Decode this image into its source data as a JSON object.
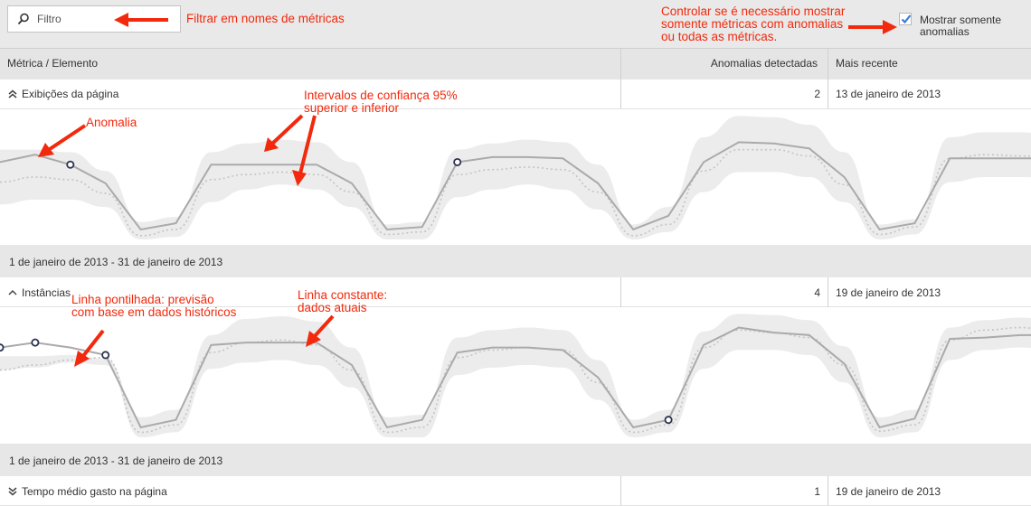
{
  "filter": {
    "placeholder": "Filtro"
  },
  "options": {
    "show_anomalies_only_label": "Mostrar somente anomalias",
    "show_anomalies_only_checked": true
  },
  "annotations": {
    "filter_note": "Filtrar em nomes de métricas",
    "toggle_note": [
      "Controlar se é necessário mostrar",
      "somente métricas com anomalias",
      "ou todas as métricas."
    ],
    "anomaly_note": "Anomalia",
    "confidence_note": [
      "Intervalos de confiança 95%",
      "superior e inferior"
    ],
    "dotted_note": [
      "Linha pontilhada: previsão",
      "com base em dados históricos"
    ],
    "solid_note": [
      "Linha constante:",
      "dados atuais"
    ]
  },
  "table": {
    "columns": [
      "Métrica / Elemento",
      "Anomalias detectadas",
      "Mais recente"
    ],
    "rows": [
      {
        "metric": "Exibições da página",
        "anomalies": "2",
        "latest": "13 de janeiro de 2013",
        "expanded": true,
        "range": "1 de janeiro de 2013 - 31 de janeiro de 2013"
      },
      {
        "metric": "Instâncias",
        "anomalies": "4",
        "latest": "19 de janeiro de 2013",
        "expanded": true,
        "range": "1 de janeiro de 2013 - 31 de janeiro de 2013"
      },
      {
        "metric": "Tempo médio gasto na página",
        "anomalies": "1",
        "latest": "19 de janeiro de 2013",
        "expanded": false
      }
    ]
  },
  "colors": {
    "annotation": "#f2290c",
    "actual_line": "#aaaaaa",
    "band": "#ececec",
    "anomaly_marker": "#2b3350",
    "check": "#3c7bd6"
  },
  "chart_data": [
    {
      "type": "line",
      "metric": "Exibições da página",
      "x": [
        1,
        2,
        3,
        4,
        5,
        6,
        7,
        8,
        9,
        10,
        11,
        12,
        13,
        14,
        15,
        16,
        17,
        18,
        19,
        20,
        21,
        22,
        23,
        24,
        25,
        26,
        27,
        28,
        29,
        30,
        31
      ],
      "series": [
        {
          "values": [
            0.62,
            0.68,
            0.6,
            0.45,
            0.08,
            0.13,
            0.6,
            0.6,
            0.6,
            0.6,
            0.45,
            0.08,
            0.1,
            0.62,
            0.66,
            0.66,
            0.65,
            0.45,
            0.08,
            0.19,
            0.62,
            0.78,
            0.77,
            0.73,
            0.5,
            0.08,
            0.13,
            0.65,
            0.65,
            0.65,
            0.65
          ]
        },
        {
          "values": [
            0.46,
            0.5,
            0.48,
            0.37,
            0.03,
            0.08,
            0.48,
            0.52,
            0.54,
            0.52,
            0.38,
            0.04,
            0.06,
            0.52,
            0.56,
            0.58,
            0.56,
            0.38,
            0.03,
            0.12,
            0.55,
            0.72,
            0.72,
            0.67,
            0.44,
            0.04,
            0.1,
            0.65,
            0.68,
            0.67,
            0.66
          ]
        },
        {
          "values": [
            0.72,
            0.72,
            0.7,
            0.55,
            0.14,
            0.18,
            0.7,
            0.77,
            0.8,
            0.78,
            0.62,
            0.12,
            0.14,
            0.72,
            0.77,
            0.8,
            0.78,
            0.6,
            0.12,
            0.26,
            0.82,
            0.99,
            0.98,
            0.92,
            0.7,
            0.12,
            0.16,
            0.82,
            0.86,
            0.86,
            0.83
          ]
        },
        {
          "values": [
            0.28,
            0.32,
            0.32,
            0.26,
            0.0,
            0.02,
            0.3,
            0.4,
            0.44,
            0.4,
            0.26,
            0.0,
            0.0,
            0.34,
            0.4,
            0.44,
            0.4,
            0.24,
            0.0,
            0.06,
            0.38,
            0.54,
            0.54,
            0.5,
            0.3,
            0.0,
            0.04,
            0.46,
            0.5,
            0.5,
            0.49
          ]
        }
      ],
      "anomalies": [
        2,
        13
      ]
    },
    {
      "type": "line",
      "metric": "Instâncias",
      "x": [
        1,
        2,
        3,
        4,
        5,
        6,
        7,
        8,
        9,
        10,
        11,
        12,
        13,
        14,
        15,
        16,
        17,
        18,
        19,
        20,
        21,
        22,
        23,
        24,
        25,
        26,
        27,
        28,
        29,
        30,
        31
      ],
      "series": [
        {
          "values": [
            0.72,
            0.76,
            0.72,
            0.66,
            0.08,
            0.14,
            0.74,
            0.76,
            0.76,
            0.76,
            0.58,
            0.08,
            0.14,
            0.68,
            0.72,
            0.72,
            0.7,
            0.48,
            0.08,
            0.14,
            0.74,
            0.88,
            0.84,
            0.82,
            0.59,
            0.08,
            0.15,
            0.79,
            0.8,
            0.82,
            0.82
          ]
        },
        {
          "values": [
            0.54,
            0.58,
            0.62,
            0.64,
            0.04,
            0.1,
            0.68,
            0.76,
            0.78,
            0.74,
            0.54,
            0.04,
            0.08,
            0.64,
            0.7,
            0.72,
            0.7,
            0.44,
            0.04,
            0.1,
            0.72,
            0.86,
            0.84,
            0.8,
            0.58,
            0.05,
            0.1,
            0.78,
            0.86,
            0.88,
            0.85
          ]
        },
        {
          "values": [
            0.65,
            0.65,
            0.66,
            0.63,
            0.16,
            0.22,
            0.82,
            0.95,
            0.97,
            0.93,
            0.72,
            0.16,
            0.18,
            0.8,
            0.86,
            0.88,
            0.86,
            0.62,
            0.14,
            0.22,
            0.85,
            0.99,
            0.98,
            0.94,
            0.73,
            0.16,
            0.22,
            0.88,
            0.94,
            0.96,
            0.94
          ]
        },
        {
          "values": [
            0.54,
            0.56,
            0.6,
            0.58,
            0.0,
            0.04,
            0.55,
            0.6,
            0.62,
            0.58,
            0.4,
            0.0,
            0.0,
            0.5,
            0.56,
            0.58,
            0.56,
            0.3,
            0.0,
            0.04,
            0.55,
            0.7,
            0.7,
            0.66,
            0.44,
            0.0,
            0.04,
            0.62,
            0.7,
            0.72,
            0.7
          ]
        }
      ],
      "anomalies": [
        0,
        1,
        3,
        19
      ]
    }
  ]
}
